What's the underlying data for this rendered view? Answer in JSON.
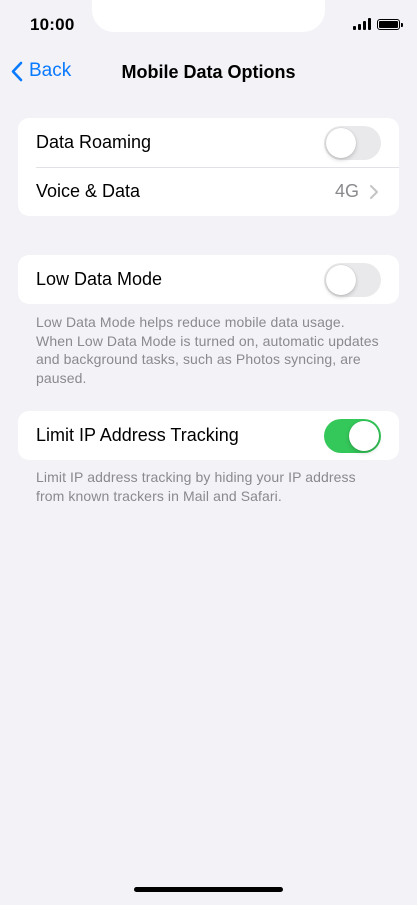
{
  "status_bar": {
    "time": "10:00"
  },
  "nav": {
    "back_label": "Back",
    "title": "Mobile Data Options"
  },
  "group1": {
    "rows": [
      {
        "label": "Data Roaming",
        "toggle_on": false
      },
      {
        "label": "Voice & Data",
        "value": "4G"
      }
    ]
  },
  "group2": {
    "rows": [
      {
        "label": "Low Data Mode",
        "toggle_on": false
      }
    ],
    "footnote": "Low Data Mode helps reduce mobile data usage. When Low Data Mode is turned on, automatic updates and background tasks, such as Photos syncing, are paused."
  },
  "group3": {
    "rows": [
      {
        "label": "Limit IP Address Tracking",
        "toggle_on": true
      }
    ],
    "footnote": "Limit IP address tracking by hiding your IP address from known trackers in Mail and Safari."
  },
  "colors": {
    "accent": "#0a7aff",
    "toggle_on": "#34c759",
    "toggle_off": "#e9e9eb",
    "background": "#f2f2f7"
  }
}
